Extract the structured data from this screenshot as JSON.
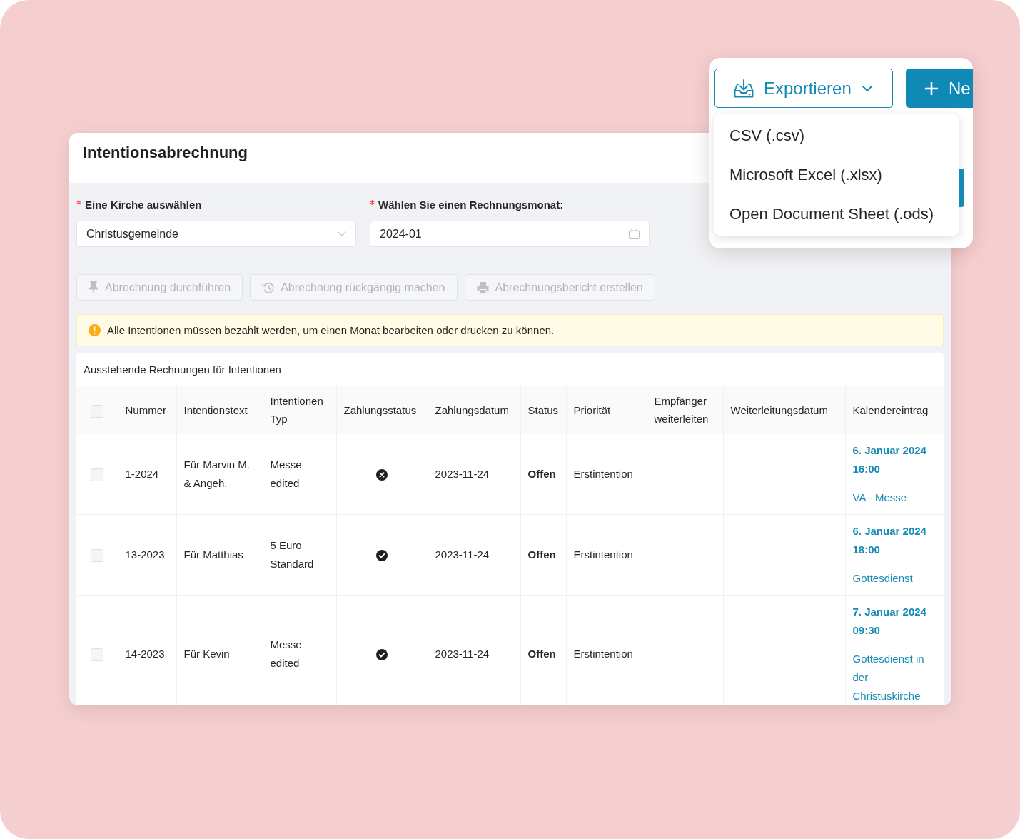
{
  "export": {
    "label": "Exportieren",
    "expanded": true,
    "options": [
      "CSV (.csv)",
      "Microsoft Excel (.xlsx)",
      "Open Document Sheet (.ods)"
    ]
  },
  "new_button": {
    "label": "Ne"
  },
  "card": {
    "title": "Intentionsabrechnung"
  },
  "form": {
    "fields": [
      {
        "kind": "select",
        "label": "Eine Kirche auswählen",
        "required": true,
        "value": "Christusgemeinde"
      },
      {
        "kind": "date",
        "label": "Wählen Sie einen Rechnungsmonat:",
        "required": true,
        "value": "2024-01"
      }
    ]
  },
  "actions": [
    {
      "kind": "pin",
      "label": "Abrechnung durchführen",
      "disabled": true
    },
    {
      "kind": "history",
      "label": "Abrechnung rückgängig machen",
      "disabled": true
    },
    {
      "kind": "print",
      "label": "Abrechnungsbericht erstellen",
      "disabled": true
    }
  ],
  "alert": {
    "kind": "warning",
    "text": "Alle Intentionen müssen bezahlt werden, um einen Monat bearbeiten oder drucken zu können."
  },
  "table": {
    "title": "Ausstehende Rechnungen für Intentionen",
    "header_checked": false,
    "columns": [
      "Nummer",
      "Intentionstext",
      "Intentionen Typ",
      "Zahlungsstatus",
      "Zahlungsdatum",
      "Status",
      "Priorität",
      "Empfänger weiterleiten",
      "Weiterleitungsdatum",
      "Kalendereintrag"
    ],
    "rows": [
      {
        "checked": false,
        "number": "1-2024",
        "intention_text": "Für Marvin M. & Angeh.",
        "intention_type": "Messe edited",
        "paid": false,
        "payment_date": "2023-11-24",
        "status": "Offen",
        "priority": "Erstintention",
        "calendar_date": "6. Januar 2024 16:00",
        "calendar_event": "VA - Messe"
      },
      {
        "checked": false,
        "number": "13-2023",
        "intention_text": "Für Matthias",
        "intention_type": "5 Euro Standard",
        "paid": true,
        "payment_date": "2023-11-24",
        "status": "Offen",
        "priority": "Erstintention",
        "calendar_date": "6. Januar 2024 18:00",
        "calendar_event": "Gottesdienst"
      },
      {
        "checked": false,
        "number": "14-2023",
        "intention_text": "Für Kevin",
        "intention_type": "Messe edited",
        "paid": true,
        "payment_date": "2023-11-24",
        "status": "Offen",
        "priority": "Erstintention",
        "calendar_date": "7. Januar 2024 09:30",
        "calendar_event": "Gottesdienst in der Christuskirche"
      }
    ]
  }
}
